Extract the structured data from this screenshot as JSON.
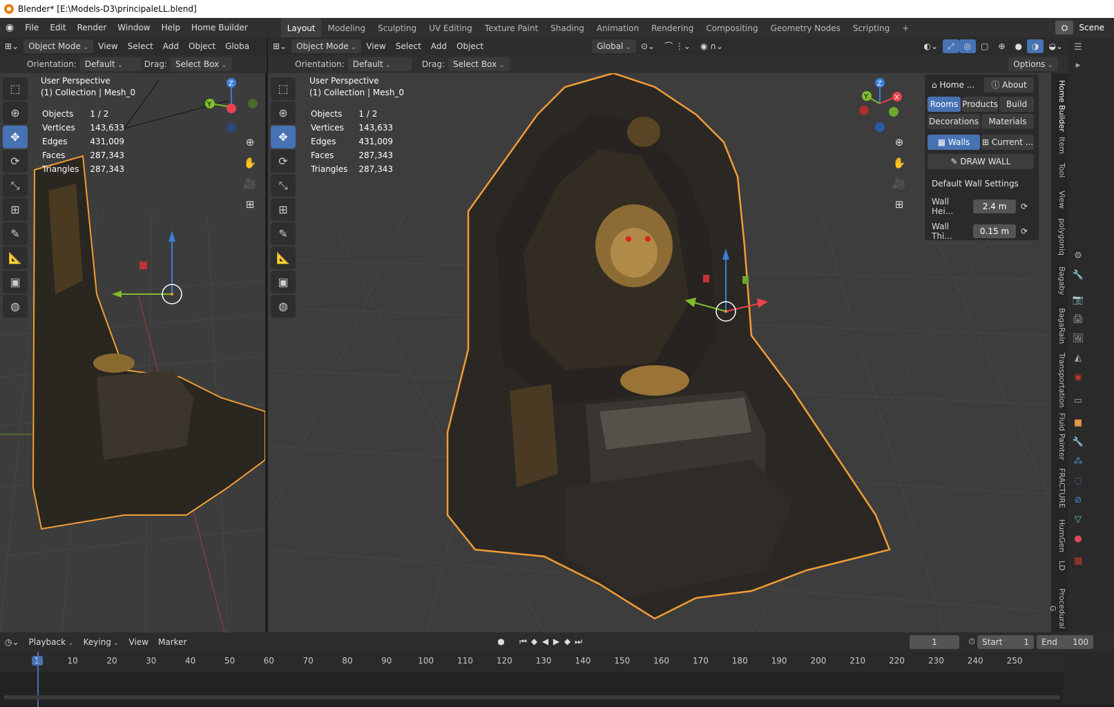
{
  "window": {
    "title": "Blender* [E:\\Models-D3\\principaleLL.blend]"
  },
  "menus": [
    "File",
    "Edit",
    "Render",
    "Window",
    "Help",
    "Home Builder"
  ],
  "workspaces": [
    "Layout",
    "Modeling",
    "Sculpting",
    "UV Editing",
    "Texture Paint",
    "Shading",
    "Animation",
    "Rendering",
    "Compositing",
    "Geometry Nodes",
    "Scripting",
    "+"
  ],
  "scene": {
    "name": "Scene"
  },
  "left_header": {
    "mode": "Object Mode",
    "view": "View",
    "select": "Select",
    "add": "Add",
    "object": "Object",
    "transform": "Globa"
  },
  "right_header": {
    "mode": "Object Mode",
    "view": "View",
    "select": "Select",
    "add": "Add",
    "object": "Object",
    "transform": "Global"
  },
  "left_sub": {
    "orientation_label": "Orientation:",
    "orientation": "Default",
    "drag_label": "Drag:",
    "drag": "Select Box"
  },
  "right_sub": {
    "orientation_label": "Orientation:",
    "orientation": "Default",
    "drag_label": "Drag:",
    "drag": "Select Box",
    "options": "Options"
  },
  "viewport": {
    "perspective": "User Perspective",
    "collection": "(1) Collection | Mesh_0"
  },
  "stats": [
    {
      "k": "Objects",
      "v": "1 / 2"
    },
    {
      "k": "Vertices",
      "v": "143,633"
    },
    {
      "k": "Edges",
      "v": "431,009"
    },
    {
      "k": "Faces",
      "v": "287,343"
    },
    {
      "k": "Triangles",
      "v": "287,343"
    }
  ],
  "gizmo": {
    "x": "X",
    "y": "Y",
    "z": "Z"
  },
  "npanel": {
    "home": "Home ...",
    "about": "About",
    "rooms": "Rooms",
    "products": "Products",
    "build": "Build",
    "decorations": "Decorations",
    "materials": "Materials",
    "walls": "Walls",
    "current": "Current ...",
    "draw_wall": "DRAW WALL",
    "settings": "Default Wall Settings",
    "wall_height_label": "Wall Hei...",
    "wall_height": "2.4 m",
    "wall_thick_label": "Wall Thi...",
    "wall_thick": "0.15 m"
  },
  "side_tabs": [
    "Home Builder",
    "Item",
    "Tool",
    "View",
    "polygoniq",
    "Bagaby",
    "BagaRain",
    "Transportation",
    "Fluid Painter",
    "FRACTURE",
    "HumGen",
    "LD",
    "Procedural G"
  ],
  "timeline": {
    "playback": "Playback",
    "keying": "Keying",
    "view": "View",
    "marker": "Marker",
    "current": "1",
    "start_label": "Start",
    "start": "1",
    "end_label": "End",
    "end": "100"
  },
  "ruler": [
    "1",
    "10",
    "20",
    "30",
    "40",
    "50",
    "60",
    "70",
    "80",
    "90",
    "100",
    "110",
    "120",
    "130",
    "140",
    "150",
    "160",
    "170",
    "180",
    "190",
    "200",
    "210",
    "220",
    "230",
    "240",
    "250"
  ],
  "colors": {
    "accent": "#4772b3",
    "select_outline": "#f29d35",
    "axis_x": "#e8434e",
    "axis_y": "#7fbe2c",
    "axis_z": "#3b7fd6"
  }
}
